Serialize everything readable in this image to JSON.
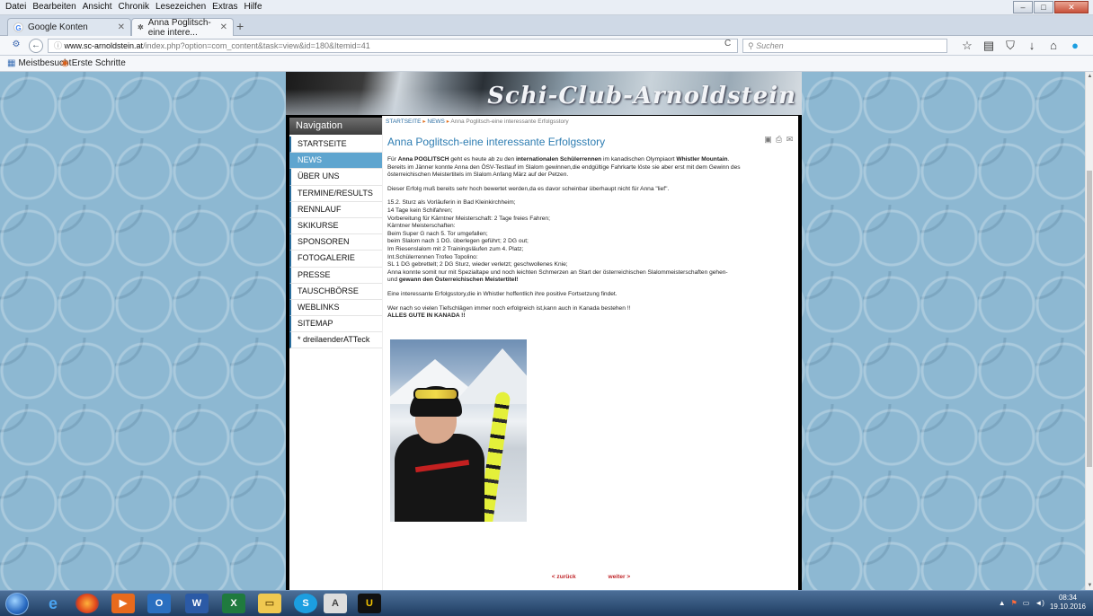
{
  "browser": {
    "menu": [
      "Datei",
      "Bearbeiten",
      "Ansicht",
      "Chronik",
      "Lesezeichen",
      "Extras",
      "Hilfe"
    ],
    "tabs": [
      {
        "label": "Google Konten",
        "icon": "google-g-icon"
      },
      {
        "label": "Anna Poglitsch-eine intere...",
        "icon": "joomla-icon"
      }
    ],
    "url_host": "www.sc-arnoldstein.at",
    "url_path": "/index.php?option=com_content&task=view&id=180&Itemid=41",
    "search_placeholder": "Suchen",
    "bookmarks": [
      "Meistbesucht",
      "Erste Schritte"
    ]
  },
  "site": {
    "logo": "Schi-Club-Arnoldstein",
    "nav_title": "Navigation",
    "nav_items": [
      {
        "label": "STARTSEITE",
        "active": false
      },
      {
        "label": "NEWS",
        "active": true
      },
      {
        "label": "ÜBER UNS",
        "active": false
      },
      {
        "label": "TERMINE/RESULTS",
        "active": false
      },
      {
        "label": "RENNLAUF",
        "active": false
      },
      {
        "label": "SKIKURSE",
        "active": false
      },
      {
        "label": "SPONSOREN",
        "active": false
      },
      {
        "label": "FOTOGALERIE",
        "active": false
      },
      {
        "label": "PRESSE",
        "active": false
      },
      {
        "label": "TAUSCHBÖRSE",
        "active": false
      },
      {
        "label": "WEBLINKS",
        "active": false
      },
      {
        "label": "SITEMAP",
        "active": false
      },
      {
        "label": "* dreilaenderATTeck",
        "active": false
      }
    ],
    "breadcrumb": [
      "STARTSEITE",
      "NEWS",
      "Anna Poglitsch-eine interessante Erfolgsstory"
    ],
    "title": "Anna Poglitsch-eine interessante Erfolgsstory",
    "intro": {
      "p1a": "Für ",
      "p1b": "Anna POGLITSCH",
      "p1c": " geht es heute ab zu den ",
      "p1d": "internationalen Schülerrennen",
      "p1e": " im kanadischen Olympiaort ",
      "p1f": "Whistler Mountain",
      "p1g": ".",
      "line2": "Bereits im Jänner konnte Anna den ÖSV-Testlauf im Slalom gewinnen,die endgültige Fahrkarte löste sie aber erst mit dem Gewinn des",
      "line3": "österreichischen Meistertitels im Slalom Anfang März auf der Petzen."
    },
    "para2": "Dieser Erfolg muß bereits sehr hoch bewertet werden,da es davor scheinbar überhaupt nicht für Anna \"lief\".",
    "list": [
      "15.2. Sturz als Vorläuferin in Bad Kleinkirchheim;",
      "14 Tage kein Schifahren;",
      "Vorbereitung für Kärntner Meisterschaft: 2 Tage  freies Fahren;",
      "Kärntner Meisterschaften:",
      "Beim Super G nach 5.  Tor umgefallen;",
      "beim Slalom nach 1 DG. überlegen geführt; 2 DG out;",
      "Im Riesenslalom mit 2 Trainingsläufen zum 4. Platz;",
      "Int.Schülerrennen Trofeo Topolino:",
      "SL 1 DG gebrettelt; 2 DG Sturz, wieder verletzt; geschwollenes Knie;",
      "Anna konnte somit nur mit Spezialtape und noch leichten Schmerzen an Start der österreichischen Slalommeisterschaften gehen-"
    ],
    "list_last_a": "und ",
    "list_last_b": "gewann den Österreichischen Meistertitel!",
    "para4": "Eine interessante Erfolgsstory,die in Whistler hoffentlich ihre positive Fortsetzung findet.",
    "para5": "Wer nach so vielen Tiefschlägen immer noch erfolgreich ist,kann auch in Kanada bestehen !!",
    "para6": "ALLES GUTE IN KANADA !!",
    "prev": "< zurück",
    "next": "weiter >"
  },
  "taskbar": {
    "time": "08:34",
    "date": "19.10.2016"
  }
}
